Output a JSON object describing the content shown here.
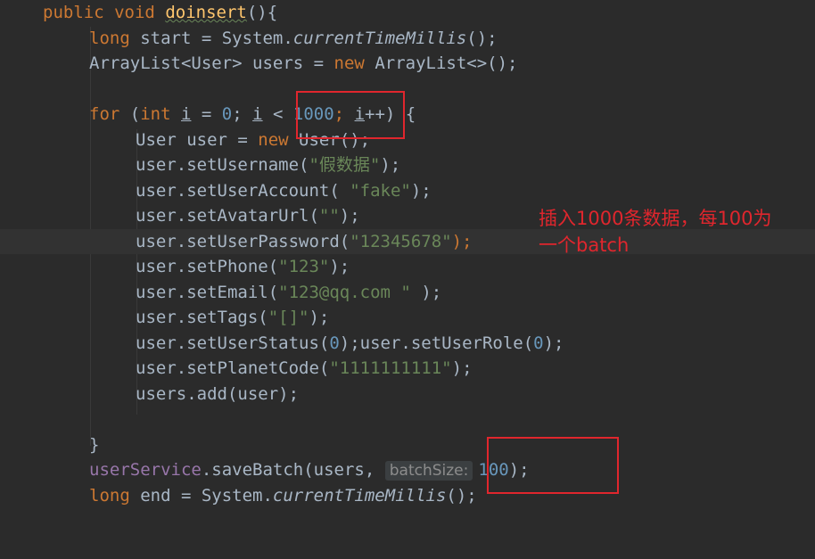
{
  "code": {
    "method_signature": {
      "modifier": "public",
      "ret": "void",
      "name": "doinsert",
      "rest": "(){"
    },
    "l2": {
      "kw": "long",
      "pre": " start = System.",
      "call": "currentTimeMillis",
      "post": "();"
    },
    "l3": {
      "pre": "ArrayList<User> users = ",
      "kw": "new",
      "post": " ArrayList<>();"
    },
    "l5": {
      "kw1": "for",
      "p1": " (",
      "kw2": "int",
      "sp": " ",
      "i1": "i",
      "p2": " = ",
      "n0": "0",
      "p3": "; ",
      "i2": "i",
      "p4": " < ",
      "n1000": "1000",
      "p5": "; ",
      "i3": "i",
      "p6": "++) {"
    },
    "l6": {
      "pre": "User user = ",
      "kw": "new",
      "post": " User();"
    },
    "l7": {
      "pre": "user.setUsername(",
      "str": "\"假数据\"",
      "post": ");"
    },
    "l8": {
      "pre": "user.setUserAccount( ",
      "str": "\"fake\"",
      "post": ");"
    },
    "l9": {
      "pre": "user.setAvatarUrl(",
      "str": "\"\"",
      "post": ");"
    },
    "l10": {
      "pre": "user.setUserPassword(",
      "str": "\"12345678\"",
      "post": ");"
    },
    "l11": {
      "pre": "user.setPhone(",
      "str": "\"123\"",
      "post": ");"
    },
    "l12": {
      "pre": "user.setEmail(",
      "str": "\"123@qq.com \"",
      "post": " );"
    },
    "l13": {
      "pre": "user.setTags(",
      "str": "\"[]\"",
      "post": ");"
    },
    "l14": {
      "pre": "user.setUserStatus(",
      "n1": "0",
      "mid": ");user.setUserRole(",
      "n2": "0",
      "post": ");"
    },
    "l15": {
      "pre": "user.setPlanetCode(",
      "str": "\"1111111111\"",
      "post": ");"
    },
    "l16": {
      "text": "users.add(user);"
    },
    "l18": {
      "text": "}"
    },
    "l19": {
      "fld": "userService",
      "pre": ".saveBatch(users, ",
      "hint": "batchSize:",
      "num": "100",
      "post": ");"
    },
    "l20": {
      "kw": "long",
      "pre": " end = System.",
      "call": "currentTimeMillis",
      "post": "();"
    }
  },
  "annotation": {
    "line1": "插入1000条数据，每100为",
    "line2": "一个batch"
  },
  "colors": {
    "background": "#2b2b2b",
    "keyword": "#cc7832",
    "string": "#6a8759",
    "number": "#6897bb",
    "method_decl": "#ffc66d",
    "field": "#9876aa",
    "annotation": "#e0262d"
  }
}
